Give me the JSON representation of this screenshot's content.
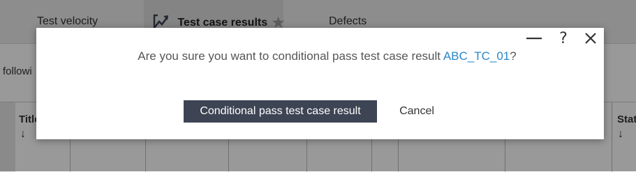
{
  "tabs": [
    {
      "label": "Test velocity",
      "icon": "chart-icon"
    },
    {
      "label": "Test case results",
      "icon": "test-results-icon",
      "active": true,
      "favorite_icon": "star-icon"
    },
    {
      "label": "Defects"
    }
  ],
  "background": {
    "instruction_fragment": "followi",
    "table_headers": [
      "Title",
      "Stat"
    ],
    "sort_arrow": "↓"
  },
  "dialog": {
    "controls": {
      "minimize": "—",
      "help": "?",
      "close": "✕"
    },
    "message_prefix": "Are you sure you want to conditional pass test case result ",
    "test_case_ref": "ABC_TC_01",
    "message_suffix": "?",
    "primary_button": "Conditional pass test case result",
    "cancel_button": "Cancel"
  },
  "colors": {
    "primary_button_bg": "#3d4454",
    "link": "#2a86c9",
    "overlay": "rgba(0,0,0,0.40)"
  }
}
